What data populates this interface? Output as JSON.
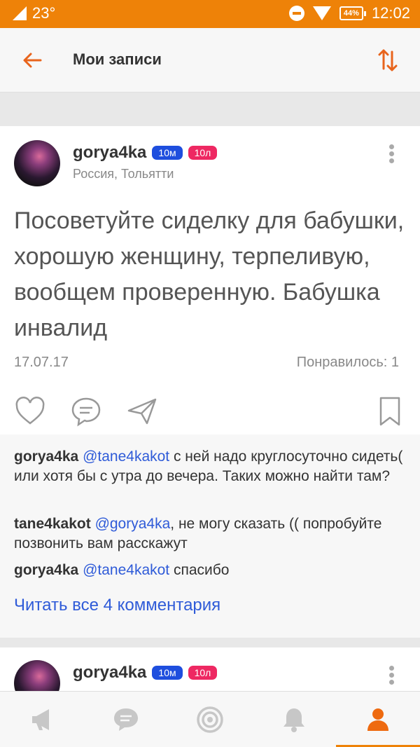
{
  "status_bar": {
    "signal_text": "23°",
    "battery": "44%",
    "time": "12:02"
  },
  "header": {
    "title": "Мои записи"
  },
  "posts": [
    {
      "author": "gorya4ka",
      "badge_blue": "10м",
      "badge_pink": "10л",
      "location": "Россия, Тольятти",
      "text": "Посоветуйте сиделку для бабушки, хорошую женщину, терпеливую, вообщем проверенную. Бабушка инвалид",
      "date": "17.07.17",
      "likes": "Понравилось: 1",
      "comments": [
        {
          "user": "gorya4ka",
          "mention": "@tane4kakot",
          "text": " с ней надо круглосуточно сидеть( или хотя бы с утра до вечера. Таких можно найти там?"
        },
        {
          "user": "tane4kakot",
          "mention": "@gorya4ka",
          "text": ", не могу сказать (( попробуйте позвонить вам расскажут"
        },
        {
          "user": "gorya4ka",
          "mention": "@tane4kakot",
          "text": " спасибо"
        }
      ],
      "read_all": "Читать все 4 комментария"
    },
    {
      "author": "gorya4ka",
      "badge_blue": "10м",
      "badge_pink": "10л"
    }
  ],
  "tabs": [
    "megaphone-icon",
    "chat-icon",
    "target-icon",
    "bell-icon",
    "profile-icon"
  ],
  "colors": {
    "accent": "#ee8208",
    "link": "#2f5bd8",
    "badge_blue": "#1e4ede",
    "badge_pink": "#ee2862"
  }
}
